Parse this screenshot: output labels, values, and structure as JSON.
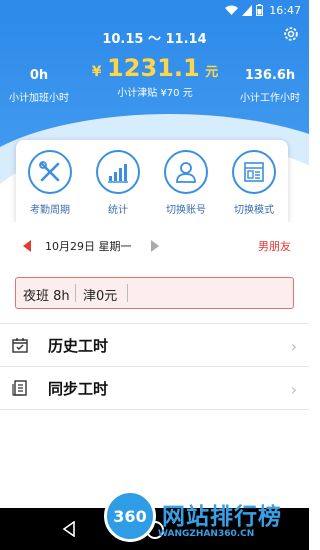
{
  "status_bar": {
    "time": "16:47",
    "icons": [
      "wifi-icon",
      "signal-icon",
      "battery-icon"
    ]
  },
  "header": {
    "date_range": "10.15 ～ 11.14",
    "left_stat": {
      "value": "0h",
      "label": "小计加班小时"
    },
    "center_stat": {
      "currency": "¥",
      "amount": "1231.1",
      "unit": "元",
      "label": "小计津贴 ¥70 元"
    },
    "right_stat": {
      "value": "136.6h",
      "label": "小计工作小时"
    }
  },
  "quick_menu": [
    {
      "label": "考勤周期",
      "icon": "tools-icon"
    },
    {
      "label": "统计",
      "icon": "bar-chart-icon"
    },
    {
      "label": "切换账号",
      "icon": "user-icon"
    },
    {
      "label": "切换模式",
      "icon": "layout-icon"
    }
  ],
  "day": {
    "date": "10月29日 星期一",
    "tag": "男朋友"
  },
  "shift": {
    "type": "夜班 8h",
    "allowance": "津0元"
  },
  "menu": [
    {
      "label": "历史工时",
      "icon": "calendar-check-icon"
    },
    {
      "label": "同步工时",
      "icon": "document-list-icon"
    }
  ],
  "watermark": {
    "badge": "360",
    "title": "网站排行榜",
    "url": "WANGZHAN360.CN"
  },
  "colors": {
    "primary": "#2f8bea",
    "accent_yellow": "#ffd54a",
    "alert_red": "#e53935"
  }
}
